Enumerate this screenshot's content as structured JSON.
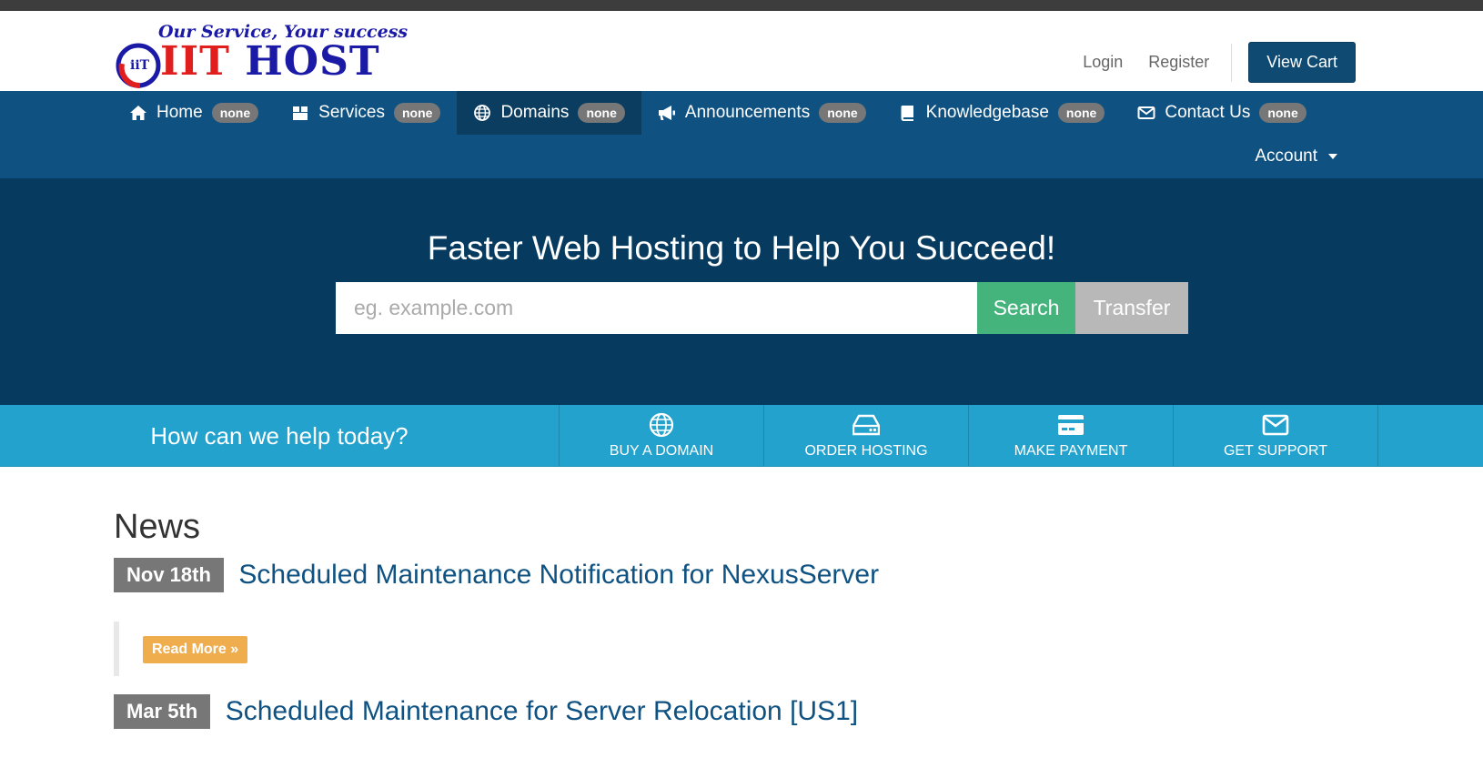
{
  "logo": {
    "tagline": "Our Service, Your success",
    "name_part1": "IIT",
    "name_part2": "HOST",
    "mark_text": "iiT"
  },
  "header": {
    "login": "Login",
    "register": "Register",
    "view_cart": "View Cart"
  },
  "nav": {
    "items": [
      {
        "label": "Home",
        "badge": "none",
        "icon": "home-icon"
      },
      {
        "label": "Services",
        "badge": "none",
        "icon": "cube-icon"
      },
      {
        "label": "Domains",
        "badge": "none",
        "icon": "globe-icon"
      },
      {
        "label": "Announcements",
        "badge": "none",
        "icon": "bullhorn-icon"
      },
      {
        "label": "Knowledgebase",
        "badge": "none",
        "icon": "book-icon"
      },
      {
        "label": "Contact Us",
        "badge": "none",
        "icon": "envelope-icon"
      }
    ],
    "account": "Account"
  },
  "hero": {
    "title": "Faster Web Hosting to Help You Succeed!",
    "search_placeholder": "eg. example.com",
    "search_button": "Search",
    "transfer_button": "Transfer"
  },
  "help": {
    "text": "How can we help today?",
    "actions": [
      {
        "label": "Buy A Domain",
        "icon": "globe-icon"
      },
      {
        "label": "Order Hosting",
        "icon": "server-icon"
      },
      {
        "label": "Make Payment",
        "icon": "credit-card-icon"
      },
      {
        "label": "Get Support",
        "icon": "envelope-icon"
      }
    ]
  },
  "news": {
    "heading": "News",
    "items": [
      {
        "date": "Nov 18th",
        "title": "Scheduled Maintenance Notification for NexusServer",
        "read_more": "Read More »"
      },
      {
        "date": "Mar 5th",
        "title": "Scheduled Maintenance for Server Relocation [US1]"
      }
    ]
  },
  "colors": {
    "nav_bg": "#0f5282",
    "hero_bg": "#063b5f",
    "help_bg": "#22a2cc",
    "search_green": "#45b37c",
    "read_more": "#f0ad4e"
  }
}
